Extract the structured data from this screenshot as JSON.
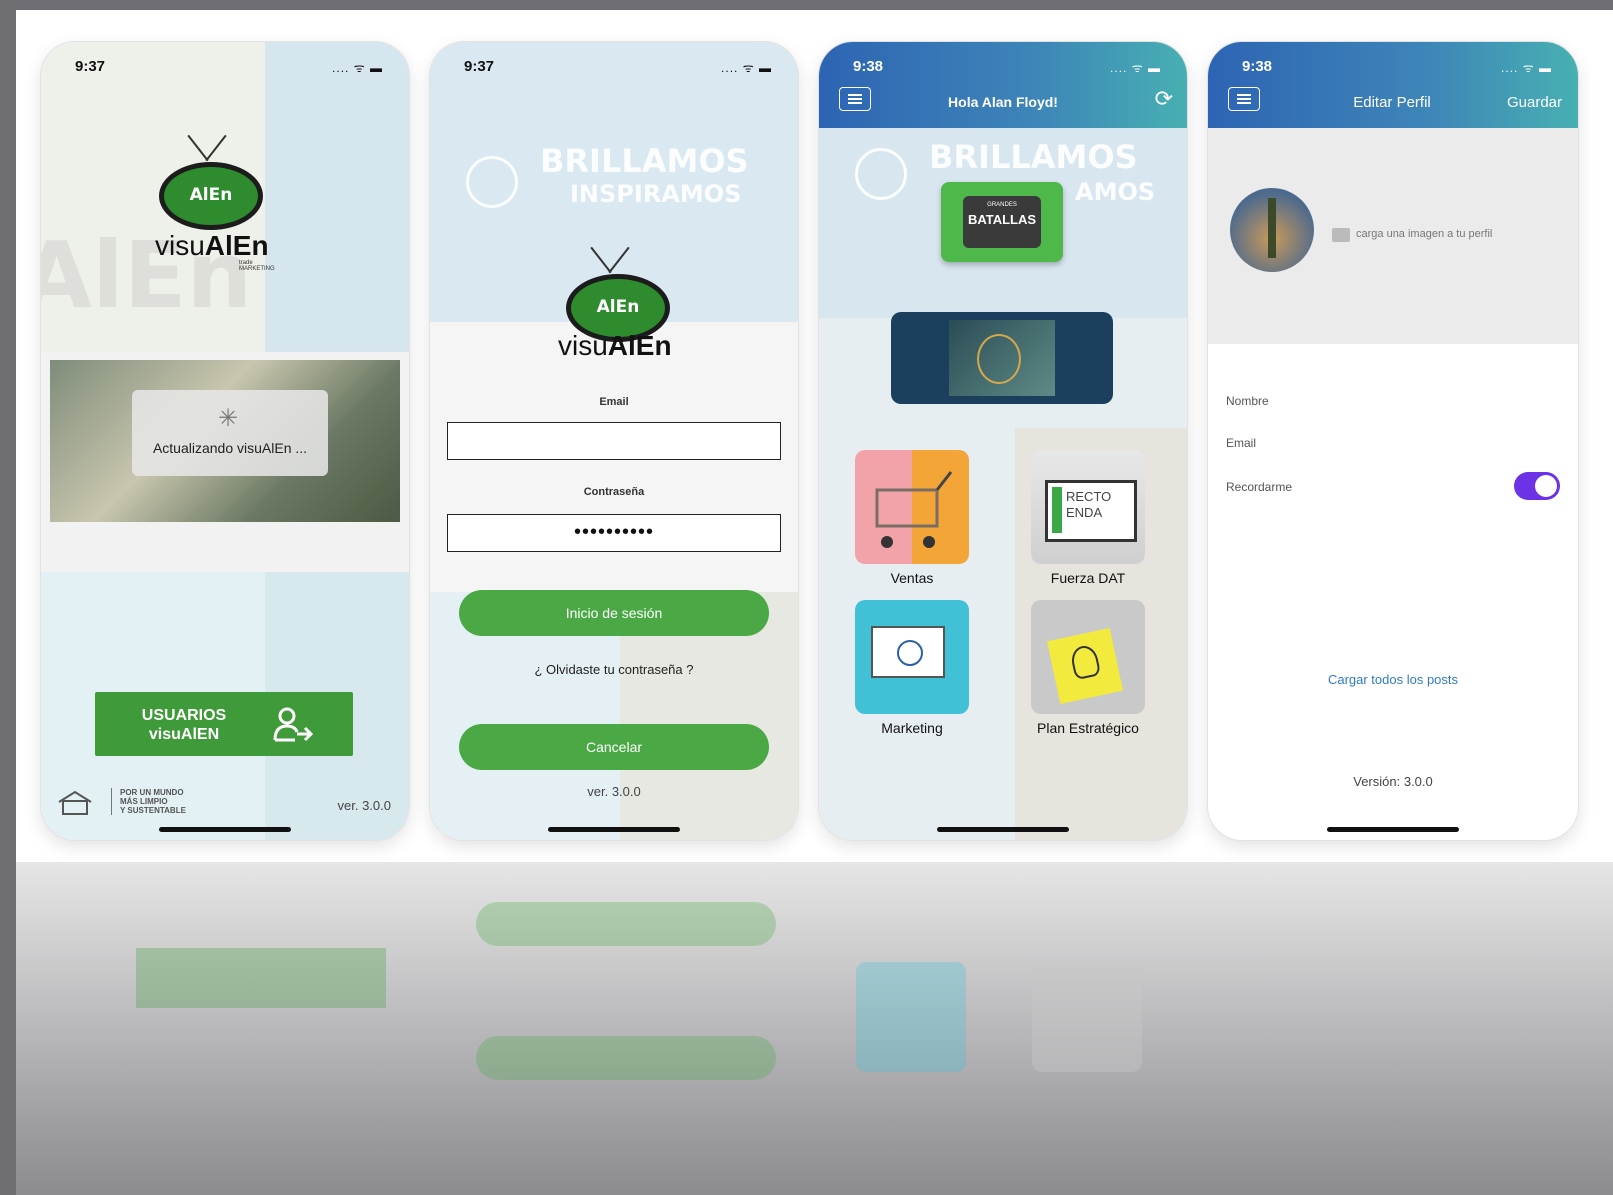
{
  "screen1": {
    "time": "9:37",
    "status_icons": ".... ᯤ ▬",
    "brand_word_light": "visu",
    "brand_word_bold": "AlEn",
    "brand_sub": "trade MARKETING",
    "logo_badge": "AlEn",
    "loading_text": "Actualizando visuAlEn ...",
    "button_label": "USUARIOS\nvisuAlEN",
    "slogan": "POR UN MUNDO\nMÁS LIMPIO\nY SUSTENTABLE",
    "version": "ver. 3.0.0"
  },
  "screen2": {
    "time": "9:37",
    "status_icons": ".... ᯤ ▬",
    "banner_line1": "BRILLAMOS",
    "banner_line2": "INSPIRAMOS",
    "brand_word_light": "visu",
    "brand_word_bold": "AlEn",
    "logo_badge": "AlEn",
    "email_label": "Email",
    "email_value": "",
    "password_label": "Contraseña",
    "password_value": "••••••••••",
    "login_button": "Inicio de sesión",
    "forgot_link": "¿ Olvidaste tu contraseña ?",
    "cancel_button": "Cancelar",
    "version": "ver. 3.0.0"
  },
  "screen3": {
    "time": "9:38",
    "status_icons": ".... ᯤ ▬",
    "title": "Hola Alan Floyd!",
    "banner_line1": "BRILLAMOS",
    "banner_line2": "AMOS",
    "batallas_small": "GRANDES",
    "batallas_big": "BATALLAS",
    "dat_text": "RECTO\nENDA",
    "tiles": [
      {
        "label": "Ventas"
      },
      {
        "label": "Fuerza DAT"
      },
      {
        "label": "Marketing"
      },
      {
        "label": "Plan Estratégico"
      }
    ]
  },
  "screen4": {
    "time": "9:38",
    "status_icons": ".... ᯤ ▬",
    "title": "Editar Perfil",
    "save": "Guardar",
    "upload_text": "carga una imagen a tu perfil",
    "name_label": "Nombre",
    "email_label": "Email",
    "remember_label": "Recordarme",
    "remember_on": true,
    "load_posts": "Cargar todos los posts",
    "version": "Versión: 3.0.0"
  },
  "colors": {
    "green": "#4aa945",
    "nav_gradient_start": "#2d64b3",
    "nav_gradient_end": "#47b0b2",
    "toggle": "#6c33e6",
    "link_blue": "#2f7bc4"
  }
}
